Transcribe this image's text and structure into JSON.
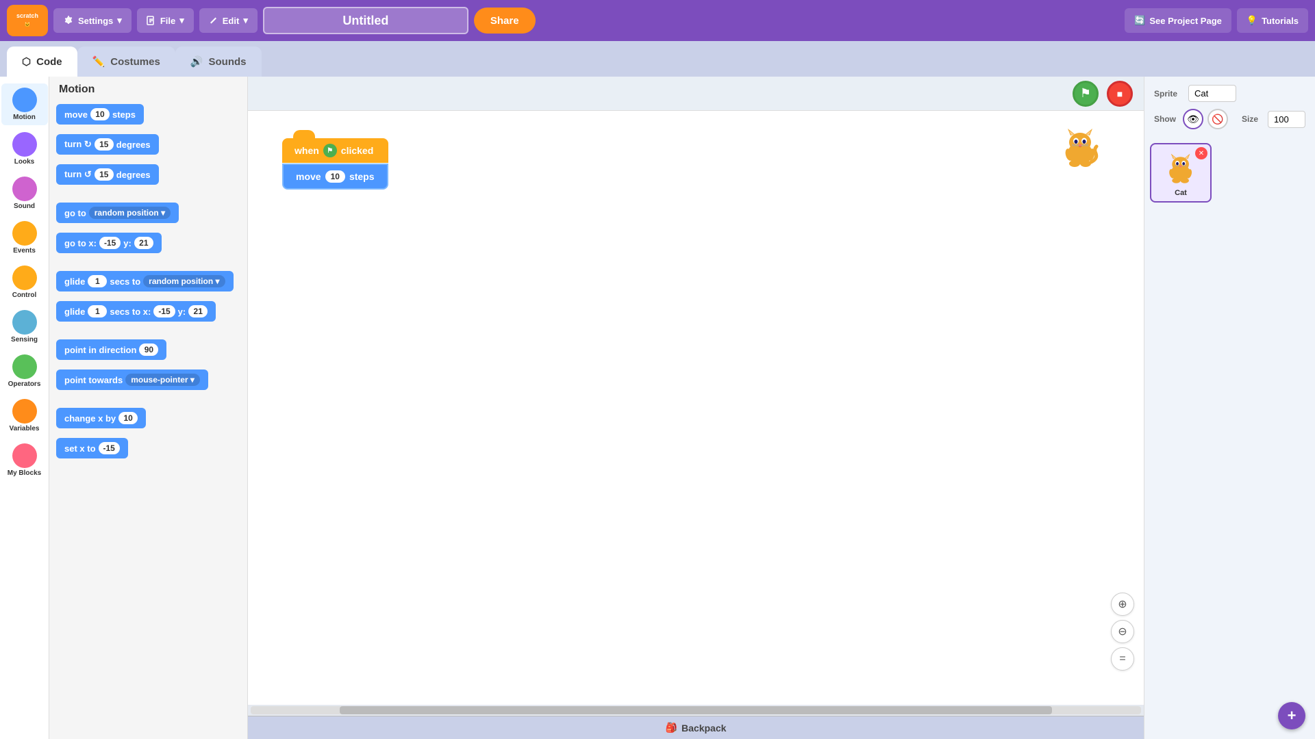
{
  "topbar": {
    "logo_text": "scratch",
    "settings_label": "Settings",
    "file_label": "File",
    "edit_label": "Edit",
    "project_title": "Untitled",
    "share_label": "Share",
    "see_project_label": "See Project Page",
    "tutorials_label": "Tutorials"
  },
  "tabs": {
    "code_label": "Code",
    "costumes_label": "Costumes",
    "sounds_label": "Sounds"
  },
  "categories": [
    {
      "id": "motion",
      "label": "Motion",
      "color": "#4c97ff"
    },
    {
      "id": "looks",
      "label": "Looks",
      "color": "#9966ff"
    },
    {
      "id": "sound",
      "label": "Sound",
      "color": "#cf63cf"
    },
    {
      "id": "events",
      "label": "Events",
      "color": "#ffab19"
    },
    {
      "id": "control",
      "label": "Control",
      "color": "#ffab19"
    },
    {
      "id": "sensing",
      "label": "Sensing",
      "color": "#5cb1d6"
    },
    {
      "id": "operators",
      "label": "Operators",
      "color": "#59c059"
    },
    {
      "id": "variables",
      "label": "Variables",
      "color": "#ff8c1a"
    },
    {
      "id": "my_blocks",
      "label": "My Blocks",
      "color": "#ff6680"
    }
  ],
  "blocks_title": "Motion",
  "blocks": [
    {
      "id": "move_steps",
      "text": "move",
      "value": "10",
      "suffix": "steps"
    },
    {
      "id": "turn_right",
      "text": "turn ↻",
      "value": "15",
      "suffix": "degrees"
    },
    {
      "id": "turn_left",
      "text": "turn ↺",
      "value": "15",
      "suffix": "degrees"
    },
    {
      "id": "go_to",
      "text": "go to",
      "dropdown": "random position"
    },
    {
      "id": "go_to_xy",
      "text": "go to x:",
      "x_value": "-15",
      "y_label": "y:",
      "y_value": "21"
    },
    {
      "id": "glide_to",
      "text": "glide",
      "sec": "1",
      "sec_suffix": "secs to",
      "dropdown": "random position"
    },
    {
      "id": "glide_xy",
      "text": "glide",
      "sec": "1",
      "sec_suffix": "secs to x:",
      "x_value": "-15",
      "y_label": "y:",
      "y_value": "21"
    },
    {
      "id": "point_direction",
      "text": "point in direction",
      "value": "90"
    },
    {
      "id": "point_towards",
      "text": "point towards",
      "dropdown": "mouse-pointer"
    },
    {
      "id": "change_x",
      "text": "change x by",
      "value": "10"
    },
    {
      "id": "set_x",
      "text": "set x to",
      "value": "-15"
    }
  ],
  "script": {
    "hat_label": "when",
    "hat_flag": "🏁",
    "hat_suffix": "clicked",
    "body_text": "move",
    "body_value": "10",
    "body_suffix": "steps"
  },
  "stage": {
    "backpack_label": "Backpack"
  },
  "sprite_panel": {
    "sprite_label": "Sprite",
    "sprite_name": "Cat",
    "show_label": "Show",
    "size_label": "Size"
  },
  "zoom": {
    "zoom_in": "+",
    "zoom_out": "−",
    "zoom_reset": "="
  }
}
